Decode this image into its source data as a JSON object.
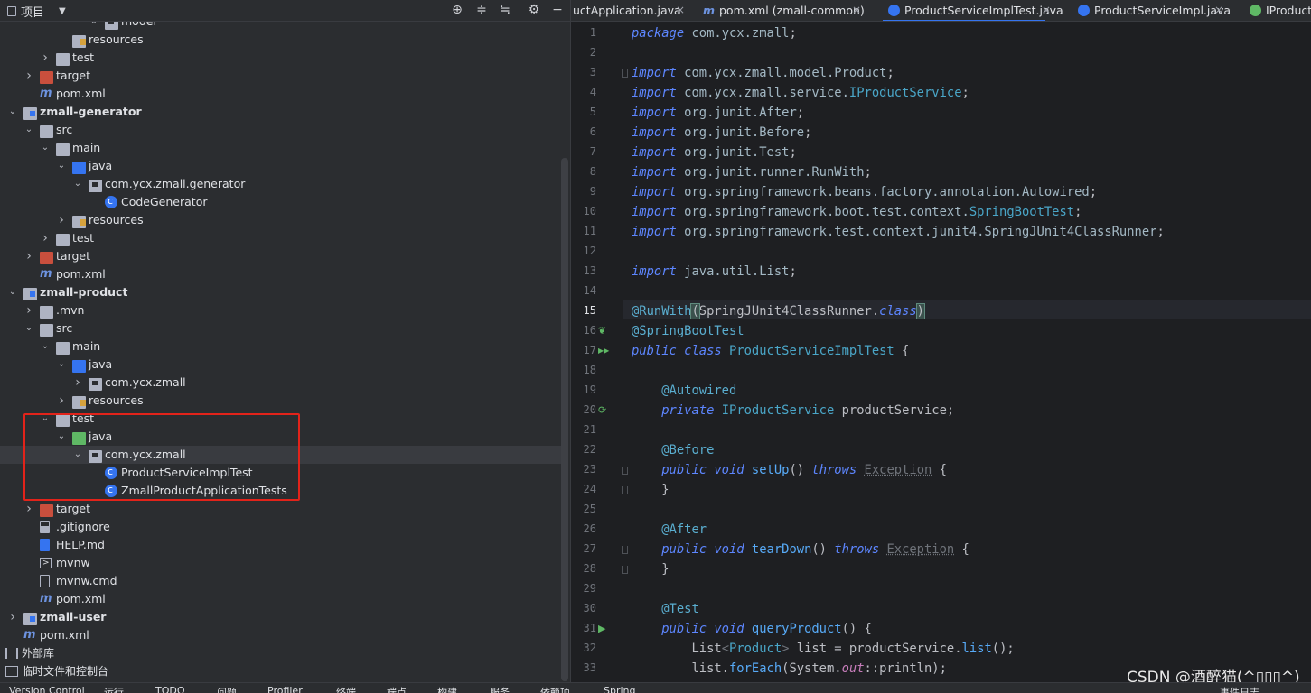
{
  "project_panel": {
    "title": "项目",
    "title_icon": "window-icon",
    "toolbar_icons": [
      "crosshair-icon",
      "expand-all-icon",
      "collapse-all-icon",
      "gear-icon"
    ],
    "tree": [
      {
        "label": "model",
        "indent": 6,
        "chev": "down",
        "icon": "pkg"
      },
      {
        "label": "resources",
        "indent": 4,
        "chev": "",
        "icon": "res"
      },
      {
        "label": "test",
        "indent": 3,
        "chev": "right",
        "icon": "grey"
      },
      {
        "label": "target",
        "indent": 2,
        "chev": "right",
        "icon": "red"
      },
      {
        "label": "pom.xml",
        "indent": 2,
        "chev": "",
        "icon": "mvn"
      },
      {
        "label": "zmall-generator",
        "indent": 1,
        "chev": "down",
        "icon": "module",
        "bold": true
      },
      {
        "label": "src",
        "indent": 2,
        "chev": "down",
        "icon": "grey"
      },
      {
        "label": "main",
        "indent": 3,
        "chev": "down",
        "icon": "grey"
      },
      {
        "label": "java",
        "indent": 4,
        "chev": "down",
        "icon": "blue"
      },
      {
        "label": "com.ycx.zmall.generator",
        "indent": 5,
        "chev": "down",
        "icon": "pkg"
      },
      {
        "label": "CodeGenerator",
        "indent": 6,
        "chev": "",
        "icon": "cls"
      },
      {
        "label": "resources",
        "indent": 4,
        "chev": "right",
        "icon": "res"
      },
      {
        "label": "test",
        "indent": 3,
        "chev": "right",
        "icon": "grey"
      },
      {
        "label": "target",
        "indent": 2,
        "chev": "right",
        "icon": "red"
      },
      {
        "label": "pom.xml",
        "indent": 2,
        "chev": "",
        "icon": "mvn"
      },
      {
        "label": "zmall-product",
        "indent": 1,
        "chev": "down",
        "icon": "module",
        "bold": true
      },
      {
        "label": ".mvn",
        "indent": 2,
        "chev": "right",
        "icon": "grey"
      },
      {
        "label": "src",
        "indent": 2,
        "chev": "down",
        "icon": "grey"
      },
      {
        "label": "main",
        "indent": 3,
        "chev": "down",
        "icon": "grey"
      },
      {
        "label": "java",
        "indent": 4,
        "chev": "down",
        "icon": "blue"
      },
      {
        "label": "com.ycx.zmall",
        "indent": 5,
        "chev": "right",
        "icon": "pkg"
      },
      {
        "label": "resources",
        "indent": 4,
        "chev": "right",
        "icon": "res"
      },
      {
        "label": "test",
        "indent": 3,
        "chev": "down",
        "icon": "grey"
      },
      {
        "label": "java",
        "indent": 4,
        "chev": "down",
        "icon": "green"
      },
      {
        "label": "com.ycx.zmall",
        "indent": 5,
        "chev": "down",
        "icon": "pkg",
        "selected": true
      },
      {
        "label": "ProductServiceImplTest",
        "indent": 6,
        "chev": "",
        "icon": "cls"
      },
      {
        "label": "ZmallProductApplicationTests",
        "indent": 6,
        "chev": "",
        "icon": "cls"
      },
      {
        "label": "target",
        "indent": 2,
        "chev": "right",
        "icon": "red"
      },
      {
        "label": ".gitignore",
        "indent": 2,
        "chev": "",
        "icon": "git"
      },
      {
        "label": "HELP.md",
        "indent": 2,
        "chev": "",
        "icon": "md"
      },
      {
        "label": "mvnw",
        "indent": 2,
        "chev": "",
        "icon": "term"
      },
      {
        "label": "mvnw.cmd",
        "indent": 2,
        "chev": "",
        "icon": "file"
      },
      {
        "label": "pom.xml",
        "indent": 2,
        "chev": "",
        "icon": "mvn"
      },
      {
        "label": "zmall-user",
        "indent": 1,
        "chev": "right",
        "icon": "module",
        "bold": true
      },
      {
        "label": "pom.xml",
        "indent": 1,
        "chev": "",
        "icon": "mvn"
      }
    ],
    "external_libraries": "外部库",
    "scratches": "临时文件和控制台"
  },
  "editor": {
    "tabs": [
      {
        "label": "uctApplication.java",
        "icon": "none",
        "active": false
      },
      {
        "label": "pom.xml (zmall-common)",
        "icon": "maven",
        "active": false
      },
      {
        "label": "ProductServiceImplTest.java",
        "icon": "class",
        "active": true
      },
      {
        "label": "ProductServiceImpl.java",
        "icon": "class",
        "active": false
      },
      {
        "label": "IProductS",
        "icon": "interface",
        "active": false
      }
    ],
    "current_line": 15,
    "lines": [
      {
        "n": 1,
        "html": "<span class='kw'>package</span> <span class='pkg'>com.ycx.zmall</span>;"
      },
      {
        "n": 2,
        "html": ""
      },
      {
        "n": 3,
        "html": "<span class='kw'>import</span> <span class='pkg'>com.ycx.zmall.model.Product</span>;"
      },
      {
        "n": 4,
        "html": "<span class='kw'>import</span> <span class='pkg'>com.ycx.zmall.service.</span><span class='type'>IProductService</span>;"
      },
      {
        "n": 5,
        "html": "<span class='kw'>import</span> <span class='pkg'>org.junit.After</span>;"
      },
      {
        "n": 6,
        "html": "<span class='kw'>import</span> <span class='pkg'>org.junit.Before</span>;"
      },
      {
        "n": 7,
        "html": "<span class='kw'>import</span> <span class='pkg'>org.junit.Test</span>;"
      },
      {
        "n": 8,
        "html": "<span class='kw'>import</span> <span class='pkg'>org.junit.runner.RunWith</span>;"
      },
      {
        "n": 9,
        "html": "<span class='kw'>import</span> <span class='pkg'>org.springframework.beans.factory.annotation.Autowired</span>;"
      },
      {
        "n": 10,
        "html": "<span class='kw'>import</span> <span class='pkg'>org.springframework.boot.test.context.</span><span class='type'>SpringBootTest</span>;"
      },
      {
        "n": 11,
        "html": "<span class='kw'>import</span> <span class='pkg'>org.springframework.test.context.junit4.SpringJUnit4ClassRunner</span>;"
      },
      {
        "n": 12,
        "html": ""
      },
      {
        "n": 13,
        "html": "<span class='kw'>import</span> <span class='pkg'>java.util.List</span>;"
      },
      {
        "n": 14,
        "html": ""
      },
      {
        "n": 15,
        "html": "<span class='ann'>@RunWith</span><span class='bracket-hl'>(</span><span class='ty2'>SpringJUnit4ClassRunner.</span><span class='kw'>class</span><span class='bracket-hl'>)</span>"
      },
      {
        "n": 16,
        "html": "<span class='ann'>@SpringBootTest</span>"
      },
      {
        "n": 17,
        "html": "<span class='kw'>public class</span> <span class='type'>ProductServiceImplTest</span> {"
      },
      {
        "n": 18,
        "html": ""
      },
      {
        "n": 19,
        "html": "    <span class='ann'>@Autowired</span>"
      },
      {
        "n": 20,
        "html": "    <span class='kw'>private</span> <span class='type'>IProductService</span> productService;"
      },
      {
        "n": 21,
        "html": ""
      },
      {
        "n": 22,
        "html": "    <span class='ann'>@Before</span>"
      },
      {
        "n": 23,
        "html": "    <span class='kw'>public void</span> <span class='meth'>setUp</span>() <span class='kw'>throws</span> <span class='under'>Exception</span> {"
      },
      {
        "n": 24,
        "html": "    }"
      },
      {
        "n": 25,
        "html": ""
      },
      {
        "n": 26,
        "html": "    <span class='ann'>@After</span>"
      },
      {
        "n": 27,
        "html": "    <span class='kw'>public void</span> <span class='meth'>tearDown</span>() <span class='kw'>throws</span> <span class='under'>Exception</span> {"
      },
      {
        "n": 28,
        "html": "    }"
      },
      {
        "n": 29,
        "html": ""
      },
      {
        "n": 30,
        "html": "    <span class='ann'>@Test</span>"
      },
      {
        "n": 31,
        "html": "    <span class='kw'>public void</span> <span class='meth'>queryProduct</span>() {"
      },
      {
        "n": 32,
        "html": "        <span class='ty2'>List</span><span class='gray'>&lt;</span><span class='type'>Product</span><span class='gray'>&gt;</span> list = productService.<span class='meth'>list</span>();"
      },
      {
        "n": 33,
        "html": "        list.<span class='meth'>forEach</span>(System.<span class='fld'>out</span>::println);"
      }
    ]
  },
  "watermark": "CSDN @酒醉猫(^▯▯▯^)",
  "status_bar": [
    "Version Control",
    "运行",
    "TODO",
    "问题",
    "Profiler",
    "终端",
    "端点",
    "构建",
    "服务",
    "依赖项",
    "Spring",
    "事件日志"
  ],
  "colors": {
    "selection_box": "#e2231a",
    "accent": "#3574f0"
  }
}
